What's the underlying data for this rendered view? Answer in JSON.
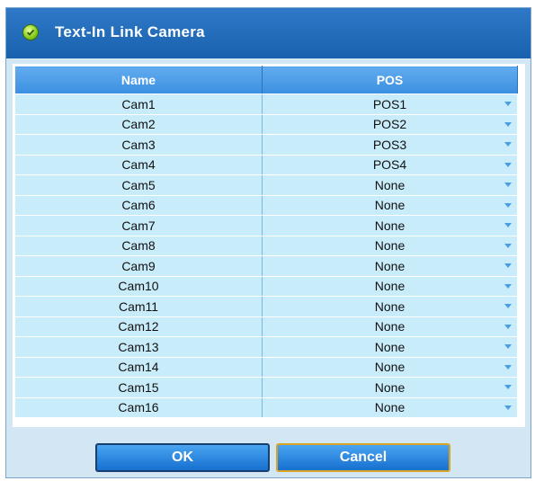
{
  "dialog": {
    "title": "Text-In Link Camera",
    "title_icon": "check-circle-icon"
  },
  "table": {
    "headers": [
      "Name",
      "POS"
    ],
    "rows": [
      {
        "name": "Cam1",
        "pos": "POS1"
      },
      {
        "name": "Cam2",
        "pos": "POS2"
      },
      {
        "name": "Cam3",
        "pos": "POS3"
      },
      {
        "name": "Cam4",
        "pos": "POS4"
      },
      {
        "name": "Cam5",
        "pos": "None"
      },
      {
        "name": "Cam6",
        "pos": "None"
      },
      {
        "name": "Cam7",
        "pos": "None"
      },
      {
        "name": "Cam8",
        "pos": "None"
      },
      {
        "name": "Cam9",
        "pos": "None"
      },
      {
        "name": "Cam10",
        "pos": "None"
      },
      {
        "name": "Cam11",
        "pos": "None"
      },
      {
        "name": "Cam12",
        "pos": "None"
      },
      {
        "name": "Cam13",
        "pos": "None"
      },
      {
        "name": "Cam14",
        "pos": "None"
      },
      {
        "name": "Cam15",
        "pos": "None"
      },
      {
        "name": "Cam16",
        "pos": "None"
      }
    ]
  },
  "buttons": {
    "ok_label": "OK",
    "cancel_label": "Cancel"
  },
  "colors": {
    "titlebar": "#1f6cbc",
    "header": "#4a9ce8",
    "row": "#c9ecfb",
    "dialog_bg": "#d3e6f4"
  }
}
